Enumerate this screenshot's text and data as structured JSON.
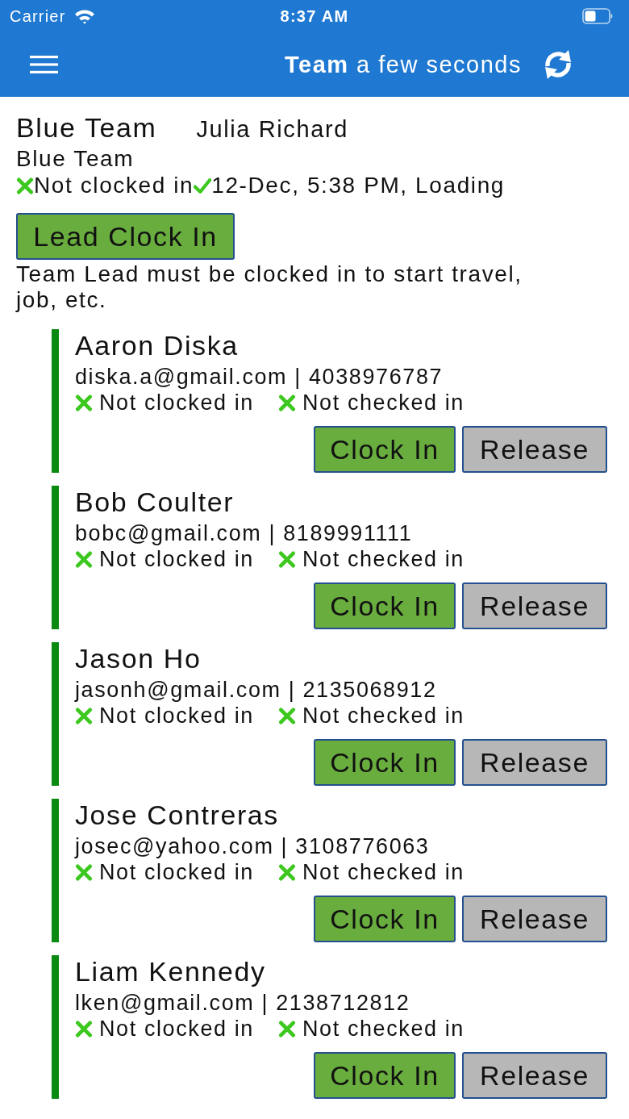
{
  "status_bar": {
    "carrier": "Carrier",
    "time": "8:37 AM"
  },
  "nav_bar": {
    "title": "**Team** a few seconds"
  },
  "team": {
    "name": "Blue Team",
    "lead_name": "Julia Richard",
    "subtitle": "Blue Team",
    "statuses": [
      {
        "text": "Not clocked in",
        "ok": false
      },
      {
        "text": "12-Dec, 5:38 PM, Loading",
        "ok": true
      }
    ],
    "button": "Lead Clock In",
    "note": "Team Lead must be clocked in to start travel, job, etc."
  },
  "members": [
    {
      "name": "Aaron Diska",
      "contact": "diska.a@gmail.com | 4038976787",
      "statuses": [
        {
          "text": "Not clocked in",
          "ok": false
        },
        {
          "text": "Not checked in",
          "ok": false
        }
      ],
      "buttons": [
        {
          "label": "Clock In",
          "kind": "clock_in"
        },
        {
          "label": "Release",
          "kind": "release"
        }
      ]
    },
    {
      "name": "Bob Coulter",
      "contact": "bobc@gmail.com | 8189991111",
      "statuses": [
        {
          "text": "Not clocked in",
          "ok": false
        },
        {
          "text": "Not checked in",
          "ok": false
        }
      ],
      "buttons": [
        {
          "label": "Clock In",
          "kind": "clock_in"
        },
        {
          "label": "Release",
          "kind": "release"
        }
      ]
    },
    {
      "name": "Jason Ho",
      "contact": "jasonh@gmail.com | 2135068912",
      "statuses": [
        {
          "text": "Not clocked in",
          "ok": false
        },
        {
          "text": "Not checked in",
          "ok": false
        }
      ],
      "buttons": [
        {
          "label": "Clock In",
          "kind": "clock_in"
        },
        {
          "label": "Release",
          "kind": "release"
        }
      ]
    },
    {
      "name": "Jose Contreras",
      "contact": "josec@yahoo.com | 3108776063",
      "statuses": [
        {
          "text": "Not clocked in",
          "ok": false
        },
        {
          "text": "Not checked in",
          "ok": false
        }
      ],
      "buttons": [
        {
          "label": "Clock In",
          "kind": "clock_in"
        },
        {
          "label": "Release",
          "kind": "release"
        }
      ]
    },
    {
      "name": "Liam Kennedy",
      "contact": "lken@gmail.com | 2138712812",
      "statuses": [
        {
          "text": "Not clocked in",
          "ok": false
        },
        {
          "text": "Not checked in",
          "ok": false
        }
      ],
      "buttons": [
        {
          "label": "Clock In",
          "kind": "clock_in"
        },
        {
          "label": "Release",
          "kind": "release"
        }
      ]
    }
  ]
}
